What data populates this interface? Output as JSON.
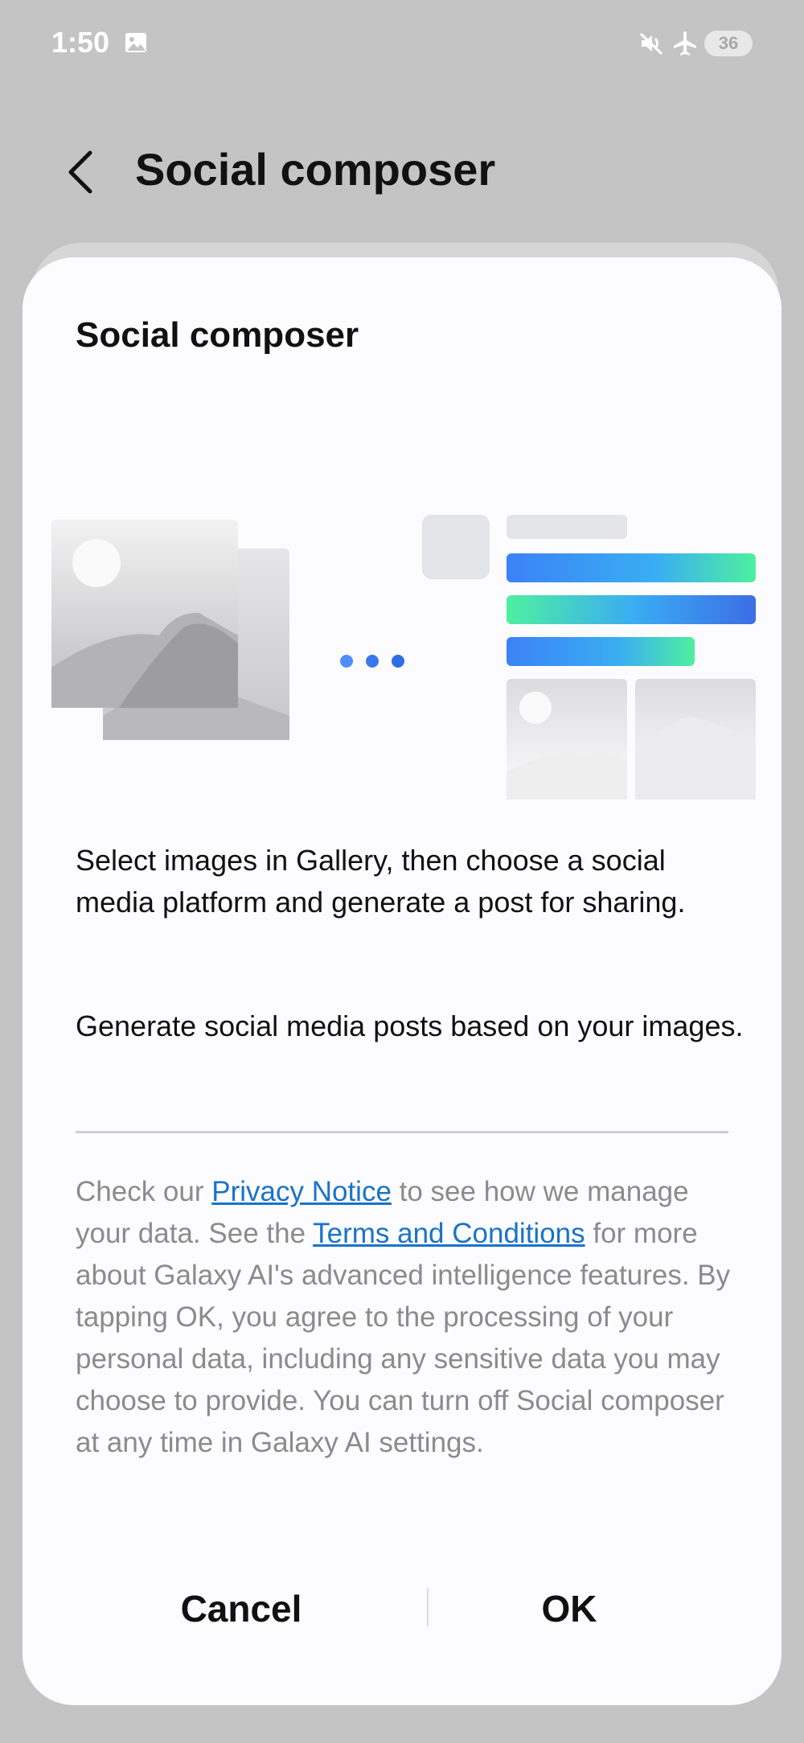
{
  "status_bar": {
    "time": "1:50",
    "battery": "36",
    "icons": [
      "image-icon",
      "mute-icon",
      "airplane-icon"
    ]
  },
  "header": {
    "title": "Social composer",
    "back_icon": "chevron-left-icon"
  },
  "dialog": {
    "title": "Social composer",
    "description_1": "Select images in Gallery, then choose a social media platform and generate a post for sharing.",
    "description_2": "Generate social media posts based on your images.",
    "legal": {
      "part_1": "Check our ",
      "privacy_link": "Privacy Notice",
      "part_2": " to see how we manage your data. See the ",
      "terms_link": "Terms and Conditions",
      "part_3": " for more about Galaxy AI's advanced intelligence features. By tapping OK, you agree to the processing of your personal data, including any sensitive data you may choose to provide. You can turn off Social composer at any time in Galaxy AI settings."
    },
    "cancel_label": "Cancel",
    "ok_label": "OK"
  },
  "colors": {
    "link": "#1a73c8",
    "bar_blue": "#3b82f6",
    "bar_green": "#4ef0a0",
    "dot_blue": "#4f8ef7"
  }
}
